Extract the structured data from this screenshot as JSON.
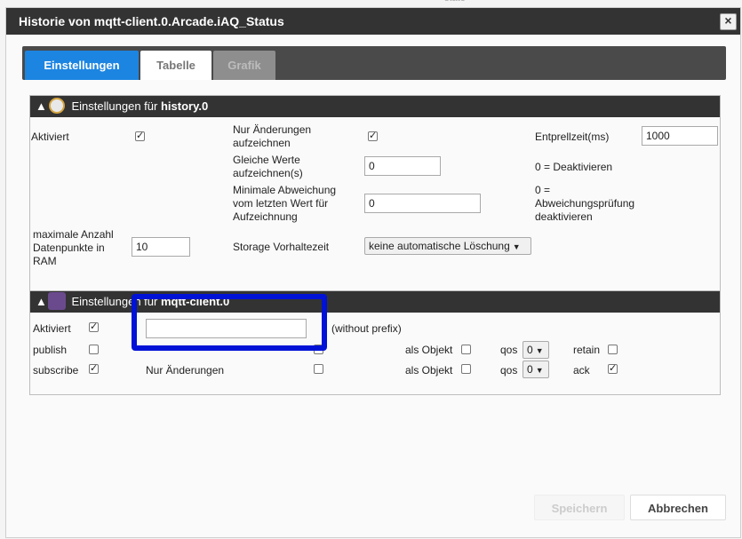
{
  "background": {
    "snippet": "state"
  },
  "dialog": {
    "title": "Historie von mqtt-client.0.Arcade.iAQ_Status",
    "close_label": "×"
  },
  "tabs": [
    {
      "label": "Einstellungen",
      "state": "active"
    },
    {
      "label": "Tabelle",
      "state": "normal"
    },
    {
      "label": "Grafik",
      "state": "disabled"
    }
  ],
  "history": {
    "header_prefix": "Einstellungen für",
    "header_instance": "history.0",
    "aktiviert_label": "Aktiviert",
    "aktiviert_checked": true,
    "nur_aenderungen_label": "Nur Änderungen aufzeichnen",
    "nur_aenderungen_checked": true,
    "entprellzeit_label": "Entprellzeit(ms)",
    "entprellzeit_value": "1000",
    "gleiche_werte_label": "Gleiche Werte aufzeichnen(s)",
    "gleiche_werte_value": "0",
    "gleiche_werte_hint": "0 = Deaktivieren",
    "min_abweichung_label": "Minimale Abweichung vom letzten Wert für Aufzeichnung",
    "min_abweichung_value": "0",
    "min_abweichung_hint": "0 = Abweichungsprüfung deaktivieren",
    "max_datenpunkte_label": "maximale Anzahl Datenpunkte in RAM",
    "max_datenpunkte_value": "10",
    "storage_label": "Storage Vorhaltezeit",
    "storage_value": "keine automatische Löschung"
  },
  "mqtt": {
    "header_prefix": "Einstellungen für",
    "header_instance": "mqtt-client.0",
    "aktiviert_label": "Aktiviert",
    "aktiviert_checked": true,
    "topic_value": "",
    "topic_hint": "(without prefix)",
    "publish_label": "publish",
    "publish_checked": false,
    "publish_changes_checked": false,
    "publish_object_label": "als Objekt",
    "publish_object_checked": false,
    "publish_qos_label": "qos",
    "publish_qos_value": "0",
    "retain_label": "retain",
    "retain_checked": false,
    "subscribe_label": "subscribe",
    "subscribe_checked": true,
    "subscribe_changes_label": "Nur Änderungen",
    "subscribe_changes_checked": false,
    "subscribe_object_label": "als Objekt",
    "subscribe_object_checked": false,
    "subscribe_qos_label": "qos",
    "subscribe_qos_value": "0",
    "ack_label": "ack",
    "ack_checked": true
  },
  "buttons": {
    "save": "Speichern",
    "cancel": "Abbrechen"
  },
  "colors": {
    "accent": "#1c85e1",
    "highlight": "#0012d6",
    "header": "#333333"
  }
}
